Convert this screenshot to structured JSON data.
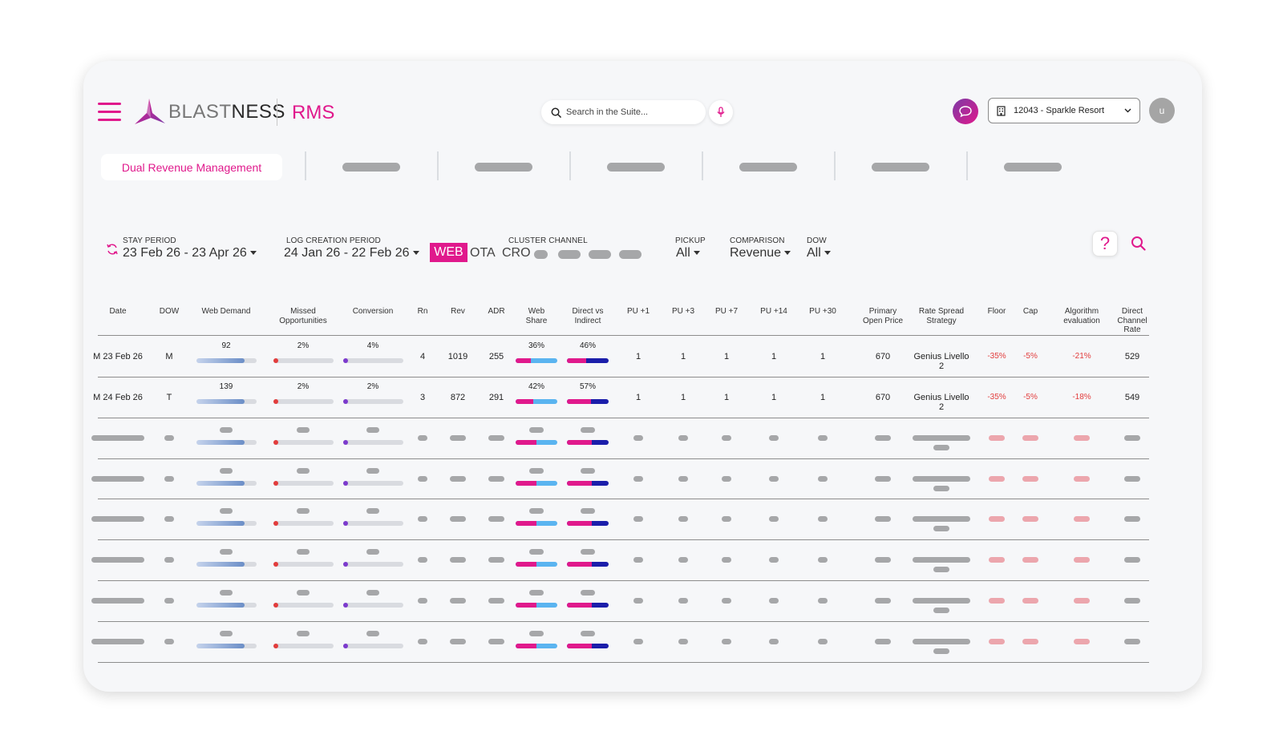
{
  "header": {
    "brand_light": "BLAST",
    "brand_bold": "NESS",
    "app_name": "RMS",
    "search_placeholder": "Search in the Suite...",
    "property_label": "12043 - Sparkle Resort",
    "avatar_initial": "u"
  },
  "tabs": {
    "active_label": "Dual Revenue Management"
  },
  "filters": {
    "stay_period_label": "STAY PERIOD",
    "stay_period_value": "23 Feb 26 - 23 Apr 26",
    "log_creation_label": "LOG CREATION PERIOD",
    "log_creation_value": "24 Jan 26 - 22 Feb 26",
    "channel_web": "WEB",
    "channel_ota": "OTA",
    "channel_cro": "CRO",
    "cluster_channel_label": "CLUSTER CHANNEL",
    "pickup_label": "PICKUP",
    "pickup_value": "All",
    "comparison_label": "COMPARISON",
    "comparison_value": "Revenue",
    "dow_label": "DOW",
    "dow_value": "All",
    "help_symbol": "?"
  },
  "table": {
    "headers": [
      {
        "key": "date",
        "l1": "Date",
        "l2": ""
      },
      {
        "key": "dow",
        "l1": "DOW",
        "l2": ""
      },
      {
        "key": "web_demand",
        "l1": "Web Demand",
        "l2": ""
      },
      {
        "key": "missed",
        "l1": "Missed",
        "l2": "Opportunities"
      },
      {
        "key": "conversion",
        "l1": "Conversion",
        "l2": ""
      },
      {
        "key": "rn",
        "l1": "Rn",
        "l2": ""
      },
      {
        "key": "rev",
        "l1": "Rev",
        "l2": ""
      },
      {
        "key": "adr",
        "l1": "ADR",
        "l2": ""
      },
      {
        "key": "web_share",
        "l1": "Web",
        "l2": "Share"
      },
      {
        "key": "direct_indirect",
        "l1": "Direct vs",
        "l2": "Indirect"
      },
      {
        "key": "pu1",
        "l1": "PU +1",
        "l2": ""
      },
      {
        "key": "pu3",
        "l1": "PU +3",
        "l2": ""
      },
      {
        "key": "pu7",
        "l1": "PU +7",
        "l2": ""
      },
      {
        "key": "pu14",
        "l1": "PU +14",
        "l2": ""
      },
      {
        "key": "pu30",
        "l1": "PU +30",
        "l2": ""
      },
      {
        "key": "primary_open_price",
        "l1": "Primary",
        "l2": "Open Price"
      },
      {
        "key": "rate_spread",
        "l1": "Rate Spread",
        "l2": "Strategy"
      },
      {
        "key": "floor",
        "l1": "Floor",
        "l2": ""
      },
      {
        "key": "cap",
        "l1": "Cap",
        "l2": ""
      },
      {
        "key": "algorithm",
        "l1": "Algorithm",
        "l2": "evaluation"
      },
      {
        "key": "direct_channel_rate",
        "l1": "Direct",
        "l2": "Channel",
        "l3": "Rate"
      }
    ],
    "rows": [
      {
        "date": "M 23 Feb 26",
        "dow": "M",
        "web_demand": "92",
        "web_demand_pct": 0.8,
        "missed": "2%",
        "conversion": "4%",
        "rn": "4",
        "rev": "1019",
        "adr": "255",
        "web_share": "36%",
        "web_share_pct": 0.36,
        "direct_indirect": "46%",
        "direct_pct": 0.46,
        "pu1": "1",
        "pu3": "1",
        "pu7": "1",
        "pu14": "1",
        "pu30": "1",
        "primary_open_price": "670",
        "rate_spread_l1": "Genius Livello",
        "rate_spread_l2": "2",
        "floor": "-35%",
        "cap": "-5%",
        "algorithm": "-21%",
        "direct_channel_rate": "529"
      },
      {
        "date": "M 24 Feb 26",
        "dow": "T",
        "web_demand": "139",
        "web_demand_pct": 0.8,
        "missed": "2%",
        "conversion": "2%",
        "rn": "3",
        "rev": "872",
        "adr": "291",
        "web_share": "42%",
        "web_share_pct": 0.42,
        "direct_indirect": "57%",
        "direct_pct": 0.57,
        "pu1": "1",
        "pu3": "1",
        "pu7": "1",
        "pu14": "1",
        "pu30": "1",
        "primary_open_price": "670",
        "rate_spread_l1": "Genius Livello",
        "rate_spread_l2": "2",
        "floor": "-35%",
        "cap": "-5%",
        "algorithm": "-18%",
        "direct_channel_rate": "549"
      }
    ],
    "placeholder_row_count": 6
  },
  "colors": {
    "accent": "#e0198c",
    "negative": "#e23c3c",
    "web_share_primary": "#e0198c",
    "web_share_secondary": "#5ab4f0",
    "direct_primary": "#e0198c",
    "direct_secondary": "#1b1eaa",
    "placeholder": "#a6a7a9",
    "placeholder_pink": "#eca6ad"
  },
  "icons": {
    "menu": "hamburger-icon",
    "search": "search-icon",
    "mic": "microphone-icon",
    "chat": "chat-icon",
    "building": "building-icon",
    "refresh": "refresh-icon",
    "help": "help-icon"
  }
}
